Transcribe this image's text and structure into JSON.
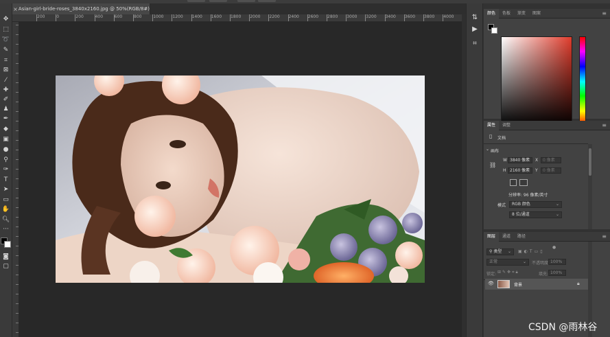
{
  "document": {
    "tab_title": "Asian-girl-bride-roses_3840x2160.jpg @ 50%(RGB/8#)",
    "close_glyph": "×"
  },
  "ruler": {
    "top_ticks": [
      "200",
      "0",
      "200",
      "400",
      "600",
      "800",
      "1000",
      "1200",
      "1400",
      "1600",
      "1800",
      "2000",
      "2200",
      "2400",
      "2600",
      "2800",
      "3000",
      "3200",
      "3400",
      "3600",
      "3800",
      "4000"
    ]
  },
  "toolbar": {
    "tools": [
      "move-tool",
      "marquee-tool",
      "lasso-tool",
      "quick-select-tool",
      "crop-tool",
      "frame-tool",
      "eyedropper-tool",
      "healing-brush-tool",
      "brush-tool",
      "clone-stamp-tool",
      "history-brush-tool",
      "eraser-tool",
      "gradient-tool",
      "blur-tool",
      "dodge-tool",
      "pen-tool",
      "type-tool",
      "path-select-tool",
      "rectangle-tool",
      "hand-tool",
      "zoom-tool",
      "more-tools",
      "color-swatches",
      "quick-mask",
      "screen-mode"
    ]
  },
  "color_panel": {
    "tabs": [
      "颜色",
      "色板",
      "渐变",
      "图案"
    ],
    "active_tab": "颜色",
    "hue_color": "#e03c2c",
    "foreground": "#000000",
    "background": "#ffffff"
  },
  "properties_panel": {
    "tabs": [
      "属性",
      "调整"
    ],
    "doc_label": "文档",
    "canvas_section": "画布",
    "width_label": "W",
    "width_value": "3840 像素",
    "height_label": "H",
    "height_value": "2160 像素",
    "x_label": "X",
    "x_placeholder": "0 像素",
    "y_label": "Y",
    "y_placeholder": "0 像素",
    "resolution": "分辨率: 96 像素/英寸",
    "mode_label": "模式",
    "mode_value": "RGB 颜色",
    "depth_value": "8 位/通道"
  },
  "layers_panel": {
    "tabs": [
      "图层",
      "通道",
      "路径"
    ],
    "filter_label": "类型",
    "blend_mode": "正常",
    "opacity_label": "不透明度:",
    "opacity_value": "100%",
    "lock_label": "锁定:",
    "fill_label": "填充:",
    "fill_value": "100%",
    "layer_name": "背景"
  },
  "watermark": "CSDN @雨林谷"
}
